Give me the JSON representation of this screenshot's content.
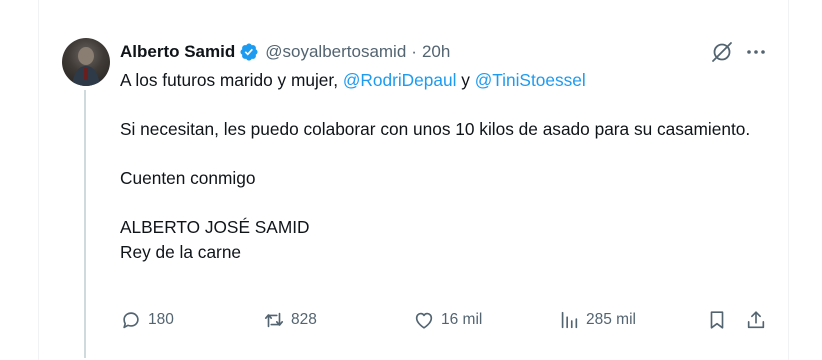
{
  "author": {
    "name": "Alberto Samid",
    "handle": "@soyalbertosamid",
    "separator": "·",
    "time": "20h"
  },
  "tweet": {
    "line1_prefix": "A los futuros marido y mujer, ",
    "mention1": "@RodriDepaul",
    "line1_middle": " y ",
    "mention2": "@TiniStoessel",
    "para2": "Si necesitan, les puedo colaborar con unos 10 kilos de asado para su casamiento.",
    "para3": "Cuenten conmigo",
    "para4_line1": "ALBERTO JOSÉ SAMID",
    "para4_line2": "Rey de la carne"
  },
  "actions": {
    "replies": "180",
    "reposts": "828",
    "likes": "16 mil",
    "views": "285 mil"
  },
  "colors": {
    "accent": "#1d9bf0",
    "muted": "#536471",
    "text": "#0f1419"
  },
  "icons": [
    "verified-badge-icon",
    "grok-icon",
    "more-icon",
    "reply-icon",
    "repost-icon",
    "like-icon",
    "views-icon",
    "bookmark-icon",
    "share-icon"
  ]
}
